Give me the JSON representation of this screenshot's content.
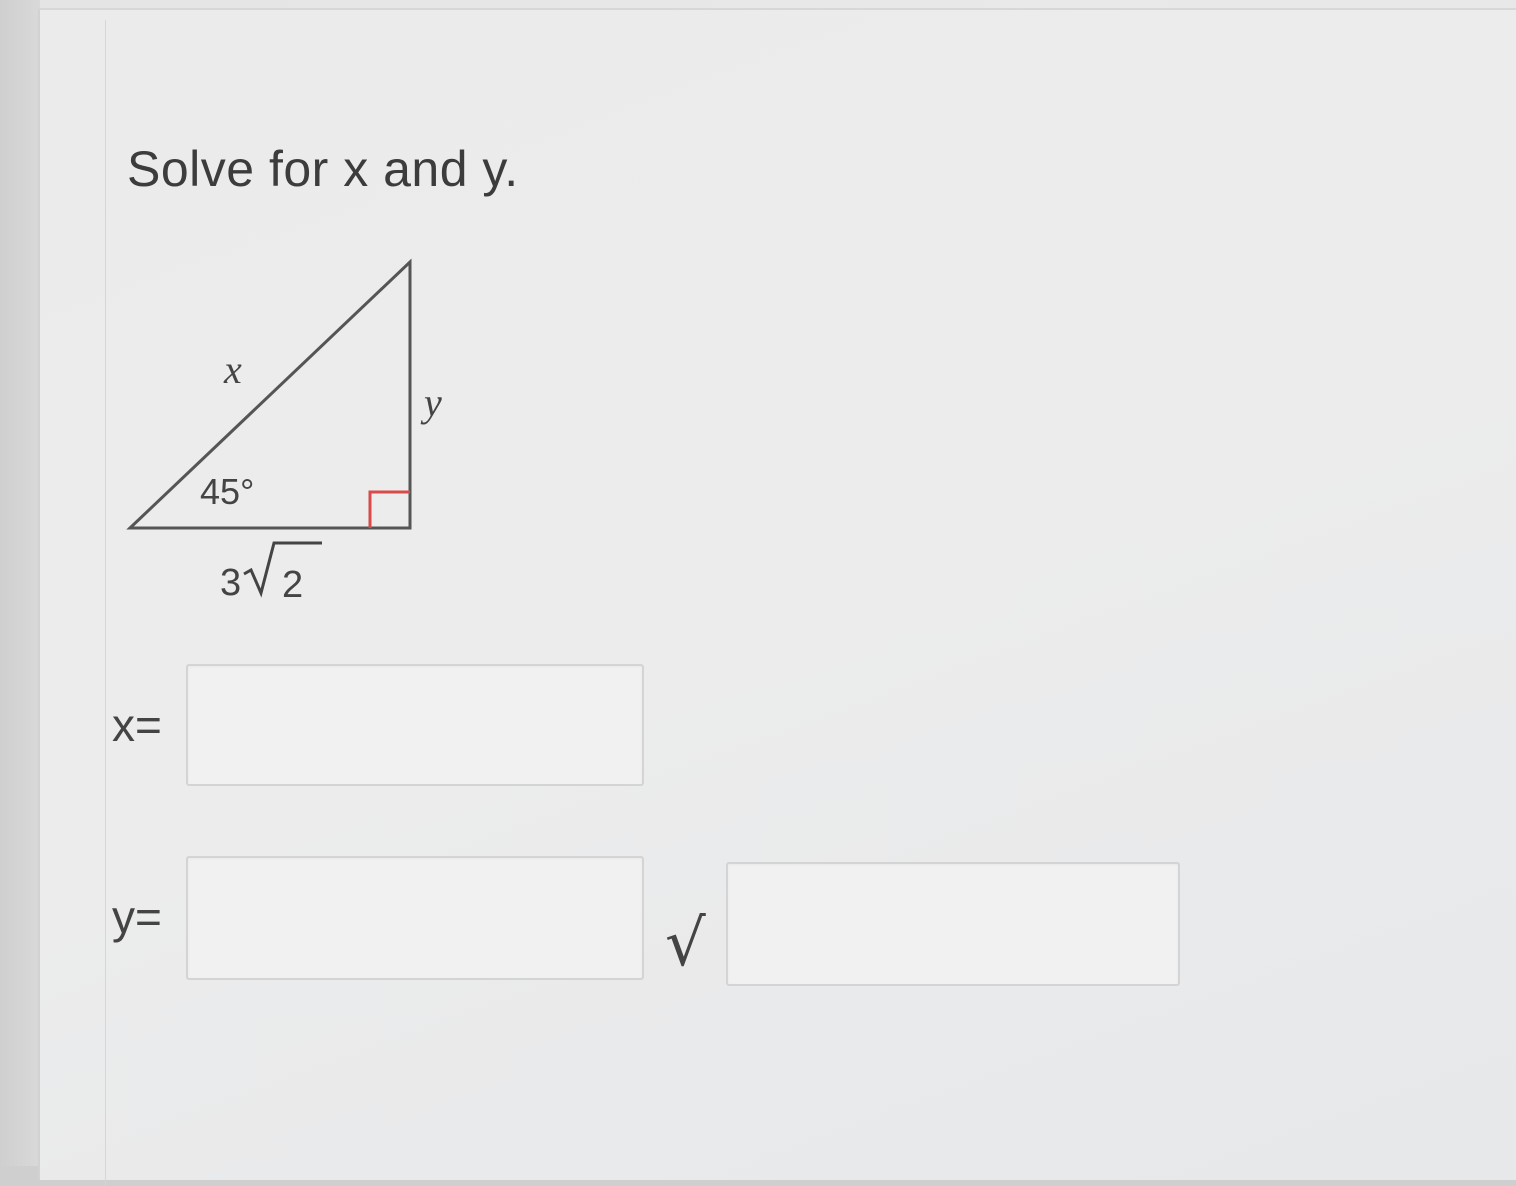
{
  "question": {
    "text": "Solve for x and y."
  },
  "diagram": {
    "hypotenuse_label": "x",
    "vertical_leg_label": "y",
    "angle_label": "45°",
    "base_coefficient": "3",
    "base_radicand": "2"
  },
  "answers": {
    "x_label": "x=",
    "y_label": "y=",
    "x_value": "",
    "y_value": "",
    "y_radicand_value": ""
  },
  "icons": {
    "sqrt": "sqrt-icon",
    "sqrt_glyph": "√"
  },
  "colors": {
    "right_angle_marker": "#d94a4a",
    "triangle_stroke": "#555555"
  }
}
